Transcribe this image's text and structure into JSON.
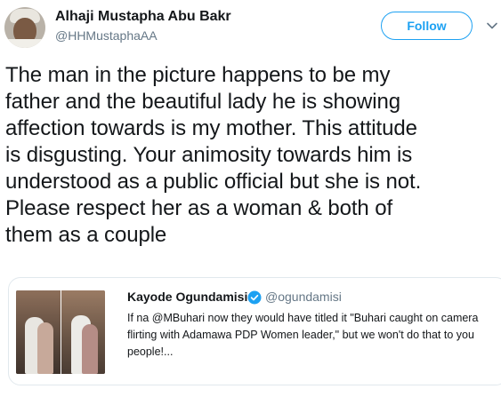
{
  "tweet": {
    "author": {
      "display_name": "Alhaji Mustapha Abu Bakr",
      "handle": "@HHMustaphaAA"
    },
    "follow_label": "Follow",
    "text": "The man in the picture happens to be my\nfather and the beautiful lady he is showing\naffection towards is my mother. This attitude\nis disgusting. Your animosity towards him is\nunderstood as a public official but she is not.\nPlease respect her as a woman & both of\nthem as a couple",
    "quoted_tweet": {
      "display_name": "Kayode Ogundamisi",
      "verified": true,
      "handle": "@ogundamisi",
      "text": "If na @MBuhari now they would have titled it \"Buhari caught on camera  flirting with Adamawa PDP Women leader,\" but we won't do that to you people!..."
    }
  },
  "colors": {
    "accent": "#1da1f2",
    "text_primary": "#14171a",
    "text_secondary": "#657786",
    "border": "#e1e8ed"
  },
  "icons": {
    "caret": "chevron-down-icon",
    "verified": "verified-badge-icon"
  }
}
